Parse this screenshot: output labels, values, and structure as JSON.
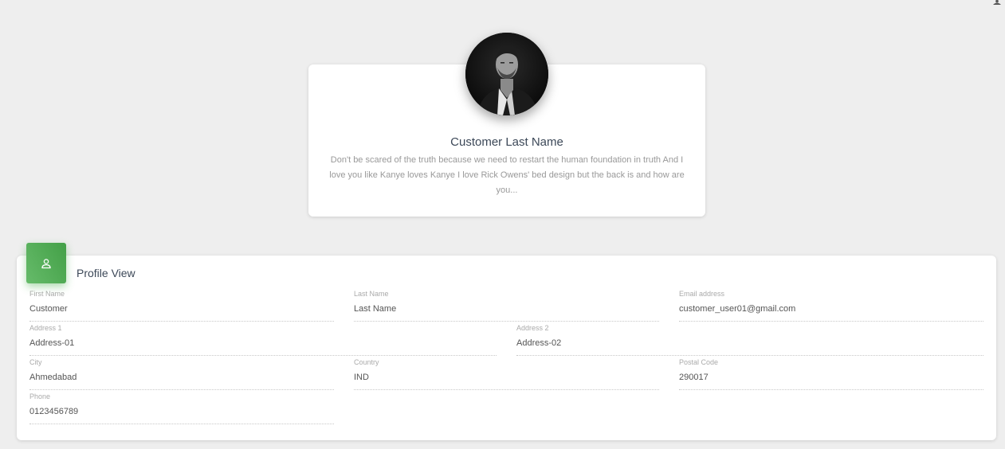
{
  "profile": {
    "name": "Customer Last Name",
    "description": "Don't be scared of the truth because we need to restart the human foundation in truth And I love you like Kanye loves Kanye I love Rick Owens' bed design but the back is and how are you..."
  },
  "form": {
    "title": "Profile View",
    "header_icon": "user-icon",
    "accent_color": "#4caf50",
    "fields": {
      "first_name": {
        "label": "First Name",
        "value": "Customer"
      },
      "last_name": {
        "label": "Last Name",
        "value": "Last Name"
      },
      "email": {
        "label": "Email address",
        "value": "customer_user01@gmail.com"
      },
      "address1": {
        "label": "Address 1",
        "value": "Address-01"
      },
      "address2": {
        "label": "Address 2",
        "value": "Address-02"
      },
      "city": {
        "label": "City",
        "value": "Ahmedabad"
      },
      "country": {
        "label": "Country",
        "value": "IND"
      },
      "postal_code": {
        "label": "Postal Code",
        "value": "290017"
      },
      "phone": {
        "label": "Phone",
        "value": "0123456789"
      }
    }
  }
}
